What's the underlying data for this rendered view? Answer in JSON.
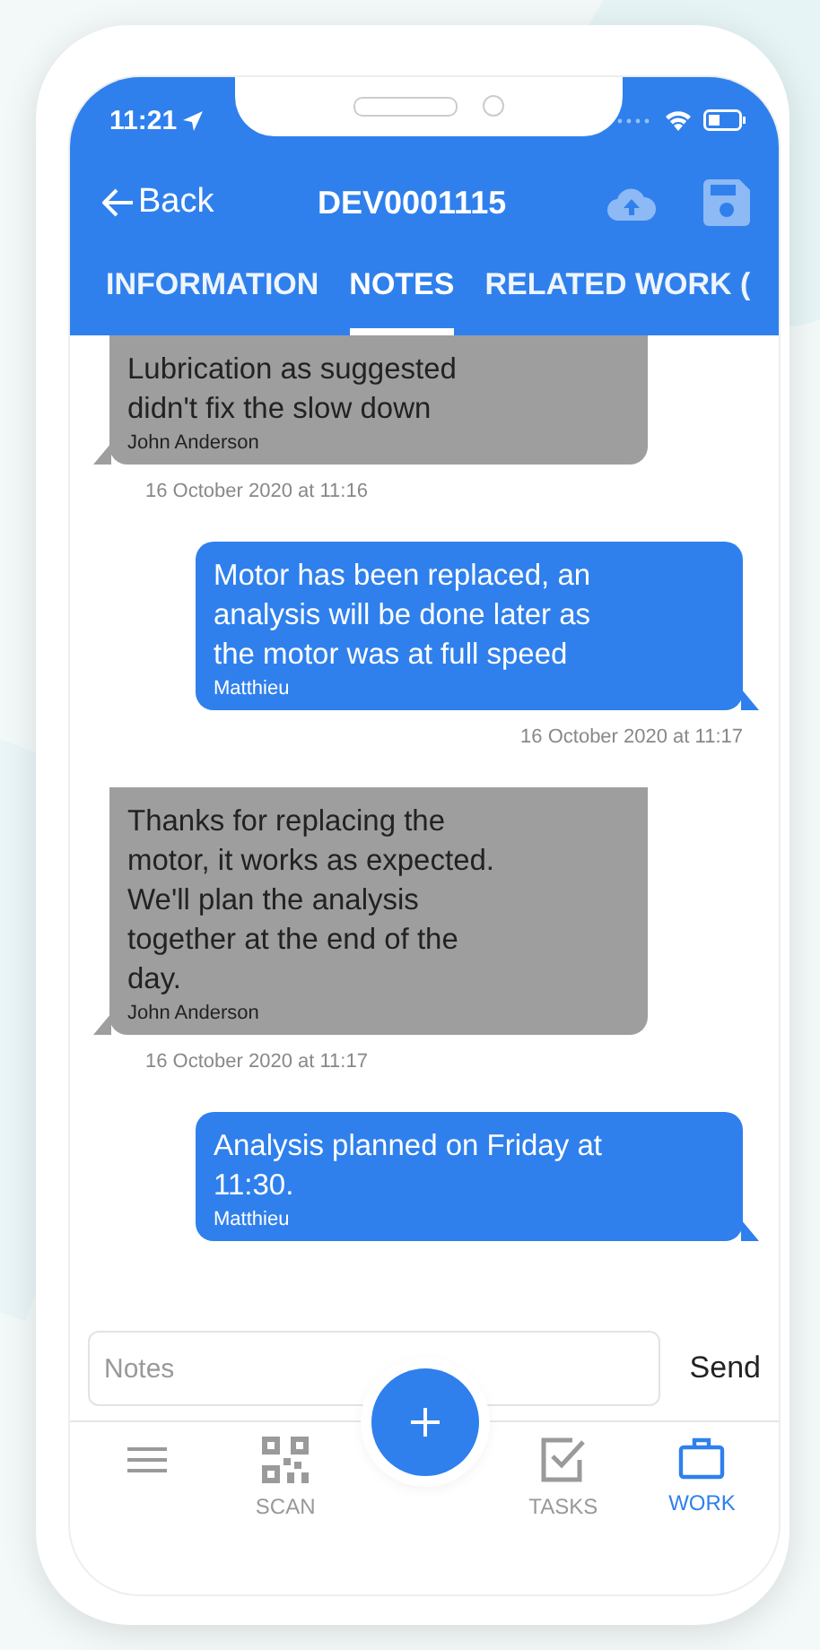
{
  "status_bar": {
    "time": "11:21"
  },
  "header": {
    "back": "Back",
    "title": "DEV0001115",
    "actions": [
      {
        "kind": "upload",
        "disabled": true
      },
      {
        "kind": "save",
        "disabled": true
      }
    ]
  },
  "tabs": [
    {
      "label": "INFORMATION",
      "selected": false
    },
    {
      "label": "NOTES",
      "selected": true
    },
    {
      "label": "RELATED WORK (",
      "selected": false
    }
  ],
  "messages": [
    {
      "kind": "received",
      "text": "Lubrication as suggested didn't fix the slow down",
      "author": "John Anderson",
      "time": "16 October 2020 at 11:16"
    },
    {
      "kind": "sent",
      "text": "Motor has been replaced, an analysis will be done later as the motor was at full speed",
      "author": "Matthieu",
      "time": "16 October 2020 at 11:17"
    },
    {
      "kind": "received",
      "text": "Thanks for replacing the motor, it works as expected. We'll plan the analysis together at the end of the day.",
      "author": "John Anderson",
      "time": "16 October 2020 at 11:17"
    },
    {
      "kind": "sent",
      "text": "Analysis planned on Friday at 11:30.",
      "author": "Matthieu"
    }
  ],
  "composer": {
    "placeholder": "Notes",
    "send": "Send"
  },
  "bottom_nav": [
    {
      "kind": "menu",
      "selected": false
    },
    {
      "kind": "scan",
      "label": "SCAN",
      "selected": false
    },
    {
      "kind": "add",
      "selected": false
    },
    {
      "kind": "tasks",
      "label": "TASKS",
      "selected": false
    },
    {
      "kind": "work",
      "label": "WORK",
      "selected": true
    }
  ]
}
